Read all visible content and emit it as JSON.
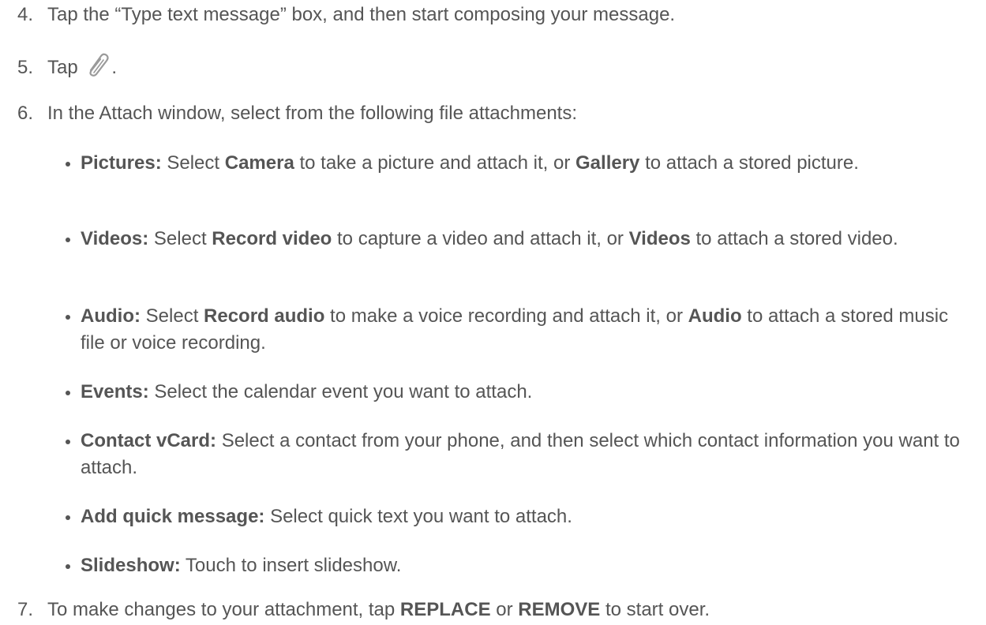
{
  "steps": [
    {
      "num": "4.",
      "text": "Tap the “Type text message” box, and then start composing your message."
    },
    {
      "num": "5.",
      "pre": "Tap",
      "post": ".",
      "icon": "paperclip-icon"
    },
    {
      "num": "6.",
      "text": "In the Attach window, select from the following file attachments:"
    },
    {
      "num": "7.",
      "pre": "To make changes to your attachment, tap ",
      "b1": "REPLACE",
      "mid": " or ",
      "b2": "REMOVE",
      "post": " to start over."
    }
  ],
  "bullets": [
    {
      "label": "Pictures:",
      "t1": " Select ",
      "b1": "Camera",
      "t2": " to take a picture and attach it, or ",
      "b2": "Gallery",
      "t3": " to attach a stored picture."
    },
    {
      "label": "Videos:",
      "t1": " Select ",
      "b1": "Record video",
      "t2": " to capture a video and attach it, or ",
      "b2": "Videos",
      "t3": " to attach a stored video."
    },
    {
      "label": "Audio:",
      "t1": " Select ",
      "b1": "Record audio",
      "t2": " to make a voice recording and attach it, or ",
      "b2": "Audio",
      "t3": " to attach a stored music file or voice recording."
    },
    {
      "label": "Events:",
      "t1": " Select the calendar event you want to attach."
    },
    {
      "label": "Contact vCard:",
      "t1": " Select a contact from your phone, and then select which contact information you want to attach."
    },
    {
      "label": "Add quick message:",
      "t1": " Select quick text you want to attach."
    },
    {
      "label": "Slideshow:",
      "t1": " Touch to insert slideshow."
    }
  ]
}
